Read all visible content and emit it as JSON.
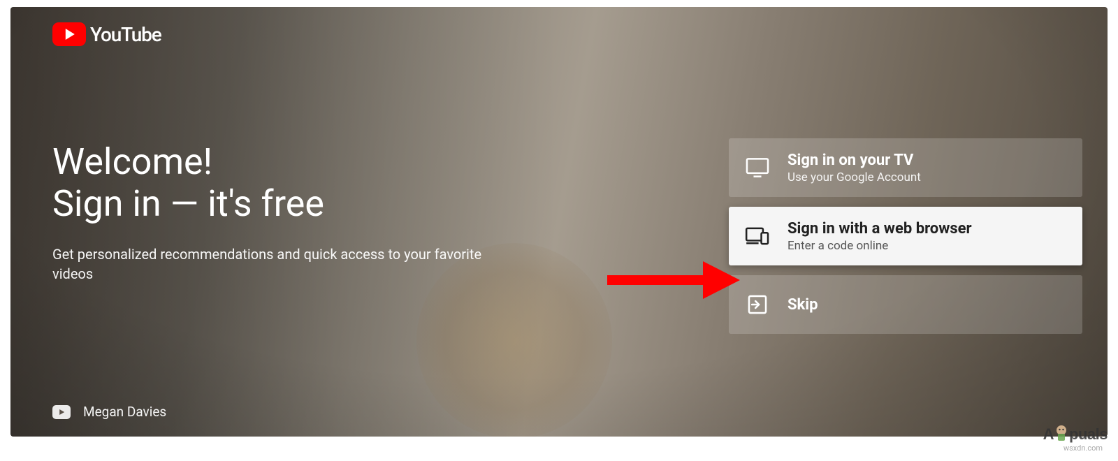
{
  "logo": {
    "brand": "YouTube"
  },
  "welcome": {
    "title_line1": "Welcome!",
    "title_line2": "Sign in — it's free",
    "subtitle": "Get personalized recommendations and quick access to your favorite videos"
  },
  "credit": {
    "channel_name": "Megan Davies"
  },
  "options": {
    "tv": {
      "title": "Sign in on your TV",
      "subtitle": "Use your Google Account"
    },
    "browser": {
      "title": "Sign in with a web browser",
      "subtitle": "Enter a code online"
    },
    "skip": {
      "title": "Skip"
    }
  },
  "annotation": {
    "arrow_color": "#ff0000"
  },
  "watermark": {
    "text_left": "A",
    "text_right": "puals",
    "domain": "wsxdn.com"
  }
}
